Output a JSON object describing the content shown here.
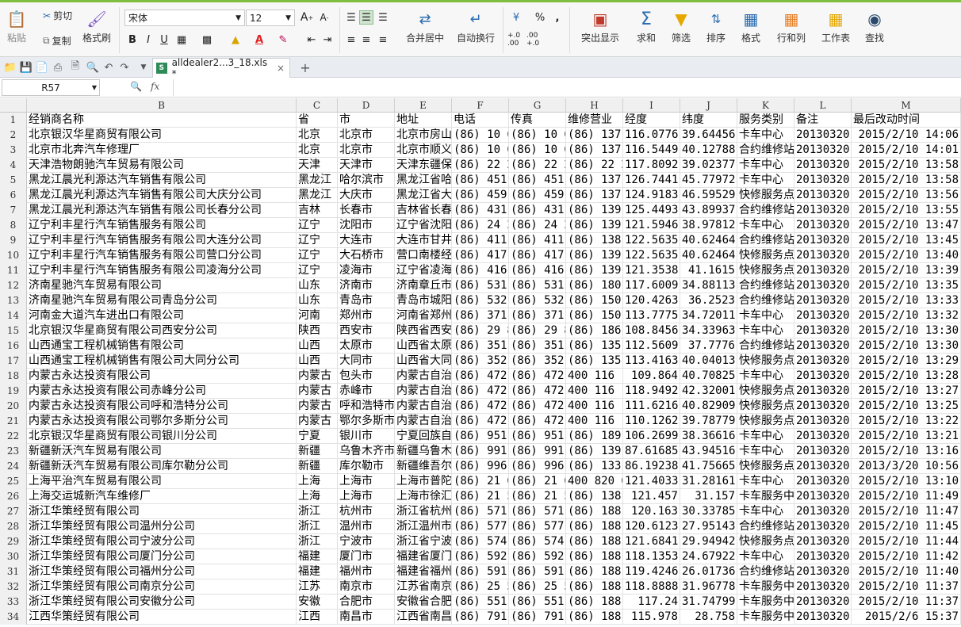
{
  "ribbon": {
    "paste_label": "粘贴",
    "cut_label": "剪切",
    "copy_label": "复制",
    "format_painter_label": "格式刷",
    "font_name": "宋体",
    "font_size": "12",
    "merge_center_label": "合并居中",
    "wrap_label": "自动换行",
    "highlight_label": "突出显示",
    "sum_label": "求和",
    "filter_label": "筛选",
    "sort_label": "排序",
    "format_label": "格式",
    "rowcol_label": "行和列",
    "worksheet_label": "工作表",
    "find_label": "查找",
    "percent_symbol": "%",
    "comma_symbol": ",",
    "bold": "B",
    "italic": "I",
    "underline": "U",
    "font_color_letter": "A",
    "dec_inc": "+.0 .00",
    "dec_dec": ".00 +.0"
  },
  "tabbar": {
    "doc_name": "alldealer2...3_18.xls *",
    "add_tab": "+"
  },
  "formula_bar": {
    "cell_ref": "R57",
    "fx": "fx",
    "content": ""
  },
  "columns": [
    "B",
    "C",
    "D",
    "E",
    "F",
    "G",
    "H",
    "I",
    "J",
    "K",
    "L",
    "M"
  ],
  "rows": [
    {
      "n": "1",
      "cells": [
        "经销商名称",
        "省",
        "市",
        "地址",
        "电话",
        "传真",
        "维修营业",
        "经度",
        "纬度",
        "服务类别",
        "备注",
        "最后改动时间"
      ]
    },
    {
      "n": "2",
      "cells": [
        "北京银汉华星商贸有限公司",
        "北京",
        "北京市",
        "北京市房山",
        "(86) 10 6",
        "(86) 10 6",
        "(86) 137",
        "116.0776",
        "39.64456",
        "卡车中心",
        "20130320",
        "2015/2/10 14:06"
      ]
    },
    {
      "n": "3",
      "cells": [
        "北京市北奔汽车修理厂",
        "北京",
        "北京市",
        "北京市顺义",
        "(86) 10 6",
        "(86) 10 6",
        "(86) 137",
        "116.5449",
        "40.12788",
        "合约维修站",
        "20130320",
        "2015/2/10 14:01"
      ]
    },
    {
      "n": "4",
      "cells": [
        "天津浩物朗驰汽车贸易有限公司",
        "天津",
        "天津市",
        "天津东疆保",
        "(86) 22 2",
        "(86) 22 2",
        "(86) 22 2",
        "117.8092",
        "39.02377",
        "卡车中心",
        "20130320",
        "2015/2/10 13:58"
      ]
    },
    {
      "n": "5",
      "cells": [
        "黑龙江晨光利源达汽车销售有限公司",
        "黑龙江",
        "哈尔滨市",
        "黑龙江省哈",
        "(86) 451",
        "(86) 451",
        "(86) 137",
        "126.7441",
        "45.77972",
        "卡车中心",
        "20130320",
        "2015/2/10 13:58"
      ]
    },
    {
      "n": "6",
      "cells": [
        "黑龙江晨光利源达汽车销售有限公司大庆分公司",
        "黑龙江",
        "大庆市",
        "黑龙江省大",
        "(86) 459",
        "(86) 459",
        "(86) 137",
        "124.9183",
        "46.59529",
        "快修服务点",
        "20130320",
        "2015/2/10 13:56"
      ]
    },
    {
      "n": "7",
      "cells": [
        "黑龙江晨光利源达汽车销售有限公司长春分公司",
        "吉林",
        "长春市",
        "吉林省长春",
        "(86) 431",
        "(86) 431",
        "(86) 139",
        "125.4493",
        "43.89937",
        "合约维修站",
        "20130320",
        "2015/2/10 13:55"
      ]
    },
    {
      "n": "8",
      "cells": [
        "辽宁利丰星行汽车销售服务有限公司",
        "辽宁",
        "沈阳市",
        "辽宁省沈阳",
        "(86) 24 2",
        "(86) 24 2",
        "(86) 139",
        "121.5946",
        "38.97812",
        "卡车中心",
        "20130320",
        "2015/2/10 13:47"
      ]
    },
    {
      "n": "9",
      "cells": [
        "辽宁利丰星行汽车销售服务有限公司大连分公司",
        "辽宁",
        "大连市",
        "大连市甘井",
        "(86) 411",
        "(86) 411",
        "(86) 138",
        "122.5635",
        "40.62464",
        "合约维修站",
        "20130320",
        "2015/2/10 13:45"
      ]
    },
    {
      "n": "10",
      "cells": [
        "辽宁利丰星行汽车销售服务有限公司营口分公司",
        "辽宁",
        "大石桥市",
        "营口南楼经",
        "(86) 417",
        "(86) 417",
        "(86) 139",
        "122.5635",
        "40.62464",
        "快修服务点",
        "20130320",
        "2015/2/10 13:40"
      ]
    },
    {
      "n": "11",
      "cells": [
        "辽宁利丰星行汽车销售服务有限公司凌海分公司",
        "辽宁",
        "凌海市",
        "辽宁省凌海",
        "(86) 416",
        "(86) 416",
        "(86) 139",
        "121.3538",
        "41.1615",
        "快修服务点",
        "20130320",
        "2015/2/10 13:39"
      ]
    },
    {
      "n": "12",
      "cells": [
        "济南星驰汽车贸易有限公司",
        "山东",
        "济南市",
        "济南章丘市",
        "(86) 531",
        "(86) 531",
        "(86) 180",
        "117.6009",
        "34.88113",
        "合约维修站",
        "20130320",
        "2015/2/10 13:35"
      ]
    },
    {
      "n": "13",
      "cells": [
        "济南星驰汽车贸易有限公司青岛分公司",
        "山东",
        "青岛市",
        "青岛市城阳",
        "(86) 532",
        "(86) 532",
        "(86) 150",
        "120.4263",
        "36.2523",
        "合约维修站",
        "20130320",
        "2015/2/10 13:33"
      ]
    },
    {
      "n": "14",
      "cells": [
        "河南金大道汽车进出口有限公司",
        "河南",
        "郑州市",
        "河南省郑州",
        "(86) 371",
        "(86) 371",
        "(86) 150",
        "113.7775",
        "34.72011",
        "卡车中心",
        "20130320",
        "2015/2/10 13:32"
      ]
    },
    {
      "n": "15",
      "cells": [
        "北京银汉华星商贸有限公司西安分公司",
        "陕西",
        "西安市",
        "陕西省西安",
        "(86) 29 8",
        "(86) 29 8",
        "(86) 186",
        "108.8456",
        "34.33963",
        "卡车中心",
        "20130320",
        "2015/2/10 13:30"
      ]
    },
    {
      "n": "16",
      "cells": [
        "山西通宝工程机械销售有限公司",
        "山西",
        "太原市",
        "山西省太原",
        "(86) 351",
        "(86) 351",
        "(86) 135",
        "112.5609",
        "37.7776",
        "合约维修站",
        "20130320",
        "2015/2/10 13:30"
      ]
    },
    {
      "n": "17",
      "cells": [
        "山西通宝工程机械销售有限公司大同分公司",
        "山西",
        "大同市",
        "山西省大同",
        "(86) 352",
        "(86) 352",
        "(86) 135",
        "113.4163",
        "40.04013",
        "快修服务点",
        "20130320",
        "2015/2/10 13:29"
      ]
    },
    {
      "n": "18",
      "cells": [
        "内蒙古永达投资有限公司",
        "内蒙古",
        "包头市",
        "内蒙古自治",
        "(86) 472",
        "(86) 472",
        "400 116 1",
        "109.864",
        "40.70825",
        "卡车中心",
        "20130320",
        "2015/2/10 13:28"
      ]
    },
    {
      "n": "19",
      "cells": [
        "内蒙古永达投资有限公司赤峰分公司",
        "内蒙古",
        "赤峰市",
        "内蒙古自治",
        "(86) 472",
        "(86) 472",
        "400 116 1",
        "118.9492",
        "42.32001",
        "快修服务点",
        "20130320",
        "2015/2/10 13:27"
      ]
    },
    {
      "n": "20",
      "cells": [
        "内蒙古永达投资有限公司呼和浩特分公司",
        "内蒙古",
        "呼和浩特市",
        "内蒙古自治",
        "(86) 472",
        "(86) 472",
        "400 116 1",
        "111.6216",
        "40.82909",
        "快修服务点",
        "20130320",
        "2015/2/10 13:25"
      ]
    },
    {
      "n": "21",
      "cells": [
        "内蒙古永达投资有限公司鄂尔多斯分公司",
        "内蒙古",
        "鄂尔多斯市",
        "内蒙古自治",
        "(86) 472",
        "(86) 472",
        "400 116 1",
        "110.1262",
        "39.78779",
        "快修服务点",
        "20130320",
        "2015/2/10 13:22"
      ]
    },
    {
      "n": "22",
      "cells": [
        "北京银汉华星商贸有限公司银川分公司",
        "宁夏",
        "银川市",
        "宁夏回族自",
        "(86) 951",
        "(86) 951",
        "(86) 189",
        "106.2699",
        "38.36616",
        "卡车中心",
        "20130320",
        "2015/2/10 13:21"
      ]
    },
    {
      "n": "23",
      "cells": [
        "新疆新沃汽车贸易有限公司",
        "新疆",
        "乌鲁木齐市",
        "新疆乌鲁木",
        "(86) 991",
        "(86) 991",
        "(86) 139",
        "87.61685",
        "43.94516",
        "卡车中心",
        "20130320",
        "2015/2/10 13:16"
      ]
    },
    {
      "n": "24",
      "cells": [
        "新疆新沃汽车贸易有限公司库尔勒分公司",
        "新疆",
        "库尔勒市",
        "新疆维吾尔",
        "(86) 996",
        "(86) 996",
        "(86) 133",
        "86.19238",
        "41.75665",
        "快修服务点",
        "20130320",
        "2013/3/20 10:56"
      ]
    },
    {
      "n": "25",
      "cells": [
        "上海平治汽车贸易有限公司",
        "上海",
        "上海市",
        "上海市普陀",
        "(86) 21 6",
        "(86) 21 6",
        "400 820 6",
        "121.4033",
        "31.28161",
        "卡车中心",
        "20130320",
        "2015/2/10 13:10"
      ]
    },
    {
      "n": "26",
      "cells": [
        "上海交运城新汽车维修厂",
        "上海",
        "上海市",
        "上海市徐汇",
        "(86) 21 5",
        "(86) 21 5",
        "(86) 138",
        "121.457",
        "31.157",
        "卡车服务中心",
        "20130320",
        "2015/2/10 11:49"
      ]
    },
    {
      "n": "27",
      "cells": [
        "浙江华策经贸有限公司",
        "浙江",
        "杭州市",
        "浙江省杭州",
        "(86) 571",
        "(86) 571",
        "(86) 188",
        "120.163",
        "30.33785",
        "卡车中心",
        "20130320",
        "2015/2/10 11:47"
      ]
    },
    {
      "n": "28",
      "cells": [
        "浙江华策经贸有限公司温州分公司",
        "浙江",
        "温州市",
        "浙江温州市",
        "(86) 577",
        "(86) 577",
        "(86) 188",
        "120.6123",
        "27.95143",
        "合约维修站",
        "20130320",
        "2015/2/10 11:45"
      ]
    },
    {
      "n": "29",
      "cells": [
        "浙江华策经贸有限公司宁波分公司",
        "浙江",
        "宁波市",
        "浙江省宁波",
        "(86) 574",
        "(86) 574",
        "(86) 188",
        "121.6841",
        "29.94942",
        "快修服务点",
        "20130320",
        "2015/2/10 11:44"
      ]
    },
    {
      "n": "30",
      "cells": [
        "浙江华策经贸有限公司厦门分公司",
        "福建",
        "厦门市",
        "福建省厦门",
        "(86) 592",
        "(86) 592",
        "(86) 188",
        "118.1353",
        "24.67922",
        "卡车中心",
        "20130320",
        "2015/2/10 11:42"
      ]
    },
    {
      "n": "31",
      "cells": [
        "浙江华策经贸有限公司福州分公司",
        "福建",
        "福州市",
        "福建省福州",
        "(86) 591",
        "(86) 591",
        "(86) 188",
        "119.4246",
        "26.01736",
        "合约维修站",
        "20130320",
        "2015/2/10 11:40"
      ]
    },
    {
      "n": "32",
      "cells": [
        "浙江华策经贸有限公司南京分公司",
        "江苏",
        "南京市",
        "江苏省南京",
        "(86) 25 5",
        "(86) 25 5",
        "(86) 188",
        "118.8888",
        "31.96778",
        "卡车服务中心",
        "20130320",
        "2015/2/10 11:37"
      ]
    },
    {
      "n": "33",
      "cells": [
        "浙江华策经贸有限公司安徽分公司",
        "安徽",
        "合肥市",
        "安徽省合肥",
        "(86) 551",
        "(86) 551",
        "(86) 188",
        "117.24",
        "31.74799",
        "卡车服务中心",
        "20130320",
        "2015/2/10 11:37"
      ]
    },
    {
      "n": "34",
      "cells": [
        "江西华策经贸有限公司",
        "江西",
        "南昌市",
        "江西省南昌",
        "(86) 791",
        "(86) 791",
        "(86) 188",
        "115.978",
        "28.758",
        "卡车服务中心",
        "20130320",
        "2015/2/6 15:37"
      ]
    }
  ]
}
